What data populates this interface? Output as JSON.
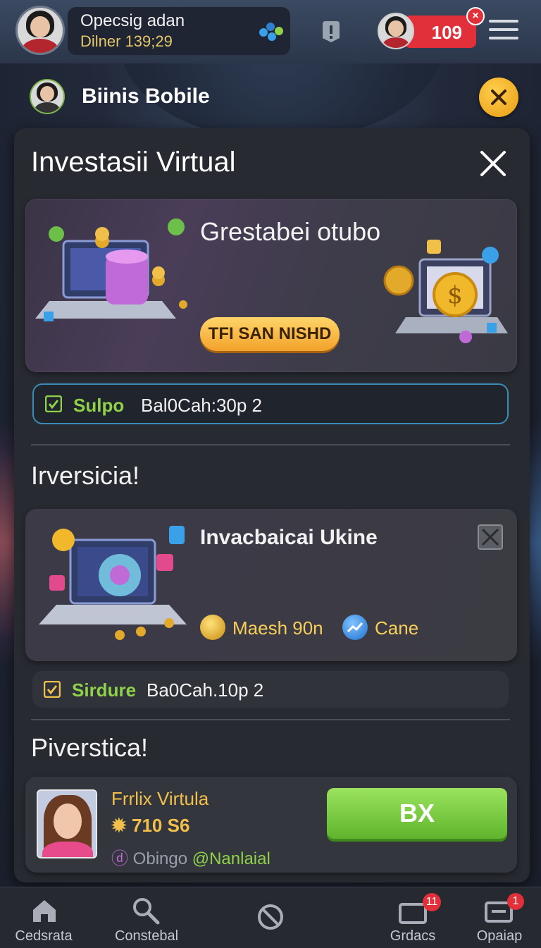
{
  "top_bar": {
    "username": "Opecsig adan",
    "timer": "Dilner 139;29",
    "opponent_score": "109",
    "score_dismiss": "×"
  },
  "sub_header": {
    "title": "Biinis Bobile"
  },
  "modal": {
    "title": "Investasii Virtual",
    "banner": {
      "title": "Grestabei otubo",
      "button_label": "TFI SAN NISHD"
    },
    "status_1": {
      "highlight": "Sulpo",
      "value": "Bal0Cah:30p 2"
    },
    "section_1_heading": "Irversicia!",
    "card": {
      "title": "Invacbaicai Ukine",
      "stat_1": "Maesh 90n",
      "stat_2": "Cane"
    },
    "status_2": {
      "highlight": "Sirdure",
      "value": "Ba0Cah.10p 2"
    },
    "section_2_heading": "Piverstica!",
    "player": {
      "name": "Frrlix Virtula",
      "score": "710 S6",
      "handle_prefix": "Obingo",
      "handle": "@Nanlaial",
      "button_label": "BX"
    }
  },
  "bottom_nav": {
    "items": [
      {
        "label": "Cedsrata",
        "icon": "home-icon"
      },
      {
        "label": "Constebal",
        "icon": "search-icon"
      },
      {
        "label": "",
        "icon": "blocked-icon"
      },
      {
        "label": "Grdacs",
        "icon": "cards-icon",
        "badge": "11"
      },
      {
        "label": "Opaiap",
        "icon": "wallet-icon",
        "badge": "1"
      }
    ]
  },
  "colors": {
    "accent_green": "#8fd24a",
    "accent_gold": "#f2c04a",
    "alert_red": "#e1303a",
    "status_border": "#3a8bb5"
  }
}
